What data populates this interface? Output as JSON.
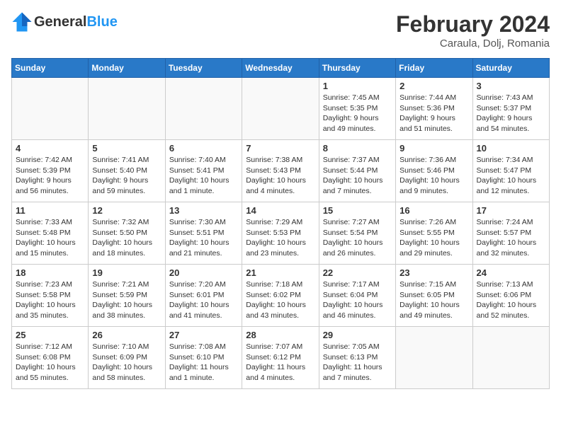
{
  "header": {
    "logo_general": "General",
    "logo_blue": "Blue",
    "month_year": "February 2024",
    "location": "Caraula, Dolj, Romania"
  },
  "days_of_week": [
    "Sunday",
    "Monday",
    "Tuesday",
    "Wednesday",
    "Thursday",
    "Friday",
    "Saturday"
  ],
  "weeks": [
    [
      {
        "day": "",
        "content": ""
      },
      {
        "day": "",
        "content": ""
      },
      {
        "day": "",
        "content": ""
      },
      {
        "day": "",
        "content": ""
      },
      {
        "day": "1",
        "content": "Sunrise: 7:45 AM\nSunset: 5:35 PM\nDaylight: 9 hours and 49 minutes."
      },
      {
        "day": "2",
        "content": "Sunrise: 7:44 AM\nSunset: 5:36 PM\nDaylight: 9 hours and 51 minutes."
      },
      {
        "day": "3",
        "content": "Sunrise: 7:43 AM\nSunset: 5:37 PM\nDaylight: 9 hours and 54 minutes."
      }
    ],
    [
      {
        "day": "4",
        "content": "Sunrise: 7:42 AM\nSunset: 5:39 PM\nDaylight: 9 hours and 56 minutes."
      },
      {
        "day": "5",
        "content": "Sunrise: 7:41 AM\nSunset: 5:40 PM\nDaylight: 9 hours and 59 minutes."
      },
      {
        "day": "6",
        "content": "Sunrise: 7:40 AM\nSunset: 5:41 PM\nDaylight: 10 hours and 1 minute."
      },
      {
        "day": "7",
        "content": "Sunrise: 7:38 AM\nSunset: 5:43 PM\nDaylight: 10 hours and 4 minutes."
      },
      {
        "day": "8",
        "content": "Sunrise: 7:37 AM\nSunset: 5:44 PM\nDaylight: 10 hours and 7 minutes."
      },
      {
        "day": "9",
        "content": "Sunrise: 7:36 AM\nSunset: 5:46 PM\nDaylight: 10 hours and 9 minutes."
      },
      {
        "day": "10",
        "content": "Sunrise: 7:34 AM\nSunset: 5:47 PM\nDaylight: 10 hours and 12 minutes."
      }
    ],
    [
      {
        "day": "11",
        "content": "Sunrise: 7:33 AM\nSunset: 5:48 PM\nDaylight: 10 hours and 15 minutes."
      },
      {
        "day": "12",
        "content": "Sunrise: 7:32 AM\nSunset: 5:50 PM\nDaylight: 10 hours and 18 minutes."
      },
      {
        "day": "13",
        "content": "Sunrise: 7:30 AM\nSunset: 5:51 PM\nDaylight: 10 hours and 21 minutes."
      },
      {
        "day": "14",
        "content": "Sunrise: 7:29 AM\nSunset: 5:53 PM\nDaylight: 10 hours and 23 minutes."
      },
      {
        "day": "15",
        "content": "Sunrise: 7:27 AM\nSunset: 5:54 PM\nDaylight: 10 hours and 26 minutes."
      },
      {
        "day": "16",
        "content": "Sunrise: 7:26 AM\nSunset: 5:55 PM\nDaylight: 10 hours and 29 minutes."
      },
      {
        "day": "17",
        "content": "Sunrise: 7:24 AM\nSunset: 5:57 PM\nDaylight: 10 hours and 32 minutes."
      }
    ],
    [
      {
        "day": "18",
        "content": "Sunrise: 7:23 AM\nSunset: 5:58 PM\nDaylight: 10 hours and 35 minutes."
      },
      {
        "day": "19",
        "content": "Sunrise: 7:21 AM\nSunset: 5:59 PM\nDaylight: 10 hours and 38 minutes."
      },
      {
        "day": "20",
        "content": "Sunrise: 7:20 AM\nSunset: 6:01 PM\nDaylight: 10 hours and 41 minutes."
      },
      {
        "day": "21",
        "content": "Sunrise: 7:18 AM\nSunset: 6:02 PM\nDaylight: 10 hours and 43 minutes."
      },
      {
        "day": "22",
        "content": "Sunrise: 7:17 AM\nSunset: 6:04 PM\nDaylight: 10 hours and 46 minutes."
      },
      {
        "day": "23",
        "content": "Sunrise: 7:15 AM\nSunset: 6:05 PM\nDaylight: 10 hours and 49 minutes."
      },
      {
        "day": "24",
        "content": "Sunrise: 7:13 AM\nSunset: 6:06 PM\nDaylight: 10 hours and 52 minutes."
      }
    ],
    [
      {
        "day": "25",
        "content": "Sunrise: 7:12 AM\nSunset: 6:08 PM\nDaylight: 10 hours and 55 minutes."
      },
      {
        "day": "26",
        "content": "Sunrise: 7:10 AM\nSunset: 6:09 PM\nDaylight: 10 hours and 58 minutes."
      },
      {
        "day": "27",
        "content": "Sunrise: 7:08 AM\nSunset: 6:10 PM\nDaylight: 11 hours and 1 minute."
      },
      {
        "day": "28",
        "content": "Sunrise: 7:07 AM\nSunset: 6:12 PM\nDaylight: 11 hours and 4 minutes."
      },
      {
        "day": "29",
        "content": "Sunrise: 7:05 AM\nSunset: 6:13 PM\nDaylight: 11 hours and 7 minutes."
      },
      {
        "day": "",
        "content": ""
      },
      {
        "day": "",
        "content": ""
      }
    ]
  ]
}
